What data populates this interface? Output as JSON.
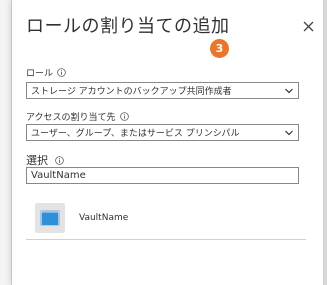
{
  "panel": {
    "title": "ロールの割り当ての追加",
    "step_number": "3"
  },
  "role": {
    "label": "ロール",
    "value": "ストレージ アカウントのバックアップ共同作成者"
  },
  "assign_access": {
    "label": "アクセスの割り当て先",
    "value": "ユーザー、グループ、またはサービス プリンシパル"
  },
  "select": {
    "label": "選択",
    "value": "VaultName"
  },
  "results": [
    {
      "name": "VaultName",
      "icon": "recovery-vault-icon"
    }
  ],
  "colors": {
    "accent_badge": "#e8762d",
    "vault_icon_blue": "#2f8fd8"
  }
}
